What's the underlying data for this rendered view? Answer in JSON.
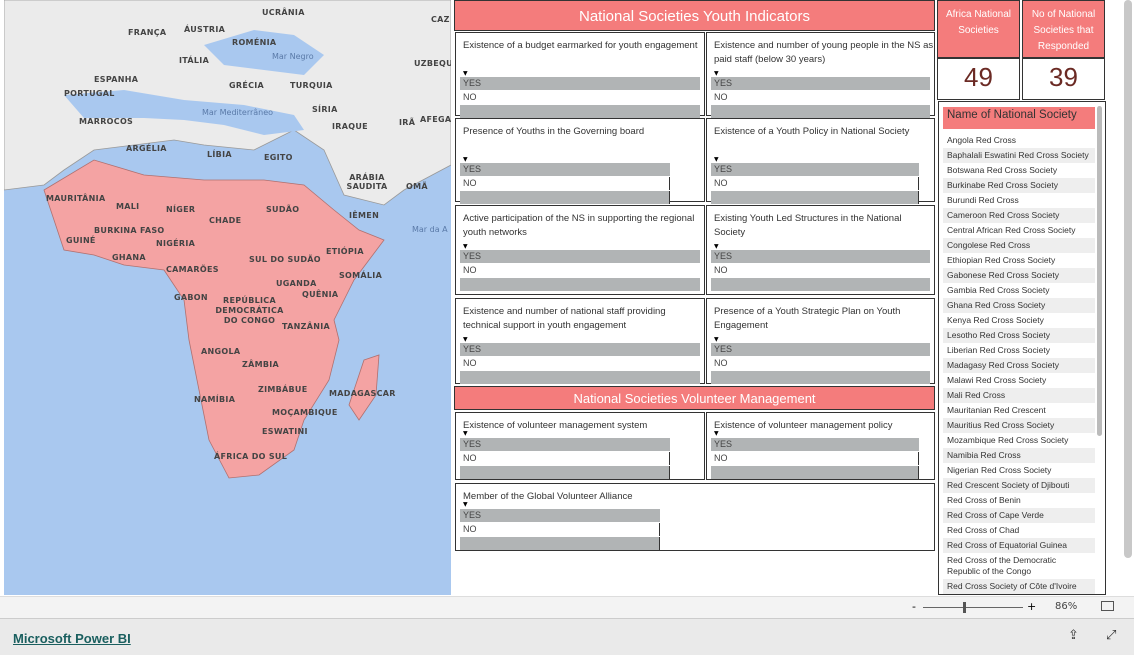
{
  "map": {
    "countries": [
      "UCRÂNIA",
      "FRANÇA",
      "ÁUSTRIA",
      "ROMÉNIA",
      "ITÁLIA",
      "ESPANHA",
      "PORTUGAL",
      "GRÉCIA",
      "TURQUIA",
      "SÍRIA",
      "IRAQUE",
      "IRÃ",
      "AFEGA",
      "MARROCOS",
      "ARGÉLIA",
      "LÍBIA",
      "EGITO",
      "ARÁBIA SAUDITA",
      "OMÃ",
      "MAURITÂNIA",
      "MALI",
      "NÍGER",
      "CHADE",
      "SUDÃO",
      "IÊMEN",
      "GUINÉ",
      "BURKINA FASO",
      "NIGÉRIA",
      "GHANA",
      "CAMARÕES",
      "SUL DO SUDÃO",
      "ETIÓPIA",
      "SOMÁLIA",
      "UGANDA",
      "QUÊNIA",
      "GABON",
      "REPÚBLICA DEMOCRÁTICA DO CONGO",
      "TANZÂNIA",
      "ANGOLA",
      "ZÂMBIA",
      "ZIMBÁBUE",
      "NAMÍBIA",
      "MOÇAMBIQUE",
      "MADAGASCAR",
      "ESWATINI",
      "ÁFRICA DO SUL",
      "CAZ",
      "UZBEQU"
    ],
    "seas": [
      "Mar Negro",
      "Mar Mediterrâneo",
      "Mar da A"
    ]
  },
  "youth": {
    "title": "National Societies Youth Indicators",
    "cards": [
      {
        "q": "Existence of a budget earmarked for youth engagement"
      },
      {
        "q": "Existence and number of young people in the NS as paid staff (below 30 years)"
      },
      {
        "q": "Presence of Youths in the Governing board"
      },
      {
        "q": "Existence of a Youth Policy in National Society"
      },
      {
        "q": "Active participation of the NS in supporting the regional youth networks"
      },
      {
        "q": "Existing Youth Led Structures in the National Society"
      },
      {
        "q": "Existence and number of national staff providing technical support in youth engagement"
      },
      {
        "q": "Presence of a Youth Strategic Plan on Youth Engagement"
      }
    ]
  },
  "volunteer": {
    "title": "National Societies Volunteer Management",
    "cards": [
      {
        "q": "Existence of volunteer management system"
      },
      {
        "q": "Existence of volunteer management policy"
      },
      {
        "q": "Member of the Global Volunteer Alliance"
      }
    ]
  },
  "options": {
    "yes": "YES",
    "no": "NO"
  },
  "kpis": [
    {
      "label": "Africa National Societies",
      "value": "49"
    },
    {
      "label": "No of National Societies that Responded",
      "value": "39"
    }
  ],
  "list": {
    "header": "Name of National Society",
    "items": [
      "Angola Red Cross",
      "Baphalali Eswatini Red Cross Society",
      "Botswana Red Cross Society",
      "Burkinabe Red Cross Society",
      "Burundi Red Cross",
      "Cameroon Red Cross Society",
      "Central African Red Cross Society",
      "Congolese Red Cross",
      "Ethiopian Red Cross Society",
      "Gabonese Red Cross Society",
      "Gambia Red Cross Society",
      "Ghana Red Cross Society",
      "Kenya Red Cross Society",
      "Lesotho Red Cross Society",
      "Liberian Red Cross Society",
      "Madagasy Red Cross Society",
      "Malawi Red Cross Society",
      "Mali Red Cross",
      "Mauritanian Red Crescent",
      "Mauritius Red Cross Society",
      "Mozambique Red Cross Society",
      "Namibia Red Cross",
      "Nigerian Red Cross Society",
      "Red Crescent Society of Djibouti",
      "Red Cross of Benin",
      "Red Cross of Cape Verde",
      "Red Cross of Chad",
      "Red Cross of Equatorial Guinea",
      "Red Cross of the Democratic Republic of the Congo",
      "Red Cross Society of Côte d'Ivoire"
    ]
  },
  "zoom": {
    "level": "86%",
    "minus": "-",
    "plus": "+",
    "value": 86
  },
  "footer": {
    "link": "Microsoft Power BI"
  }
}
